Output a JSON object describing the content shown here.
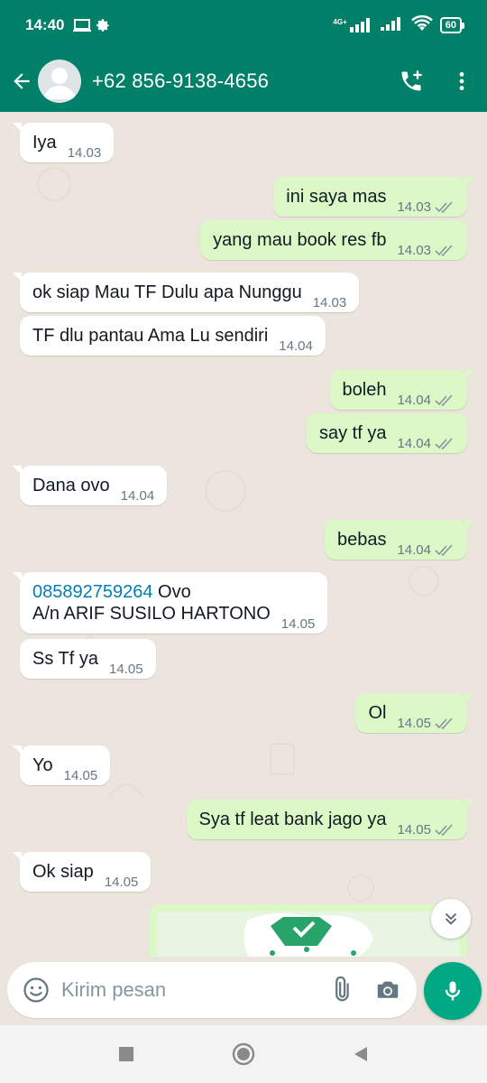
{
  "status_bar": {
    "time": "14:40",
    "network_label": "4G+",
    "battery": "60"
  },
  "header": {
    "contact_name": "+62 856-9138-4656"
  },
  "messages": [
    {
      "dir": "in",
      "text": "Iya",
      "time": "14.03"
    },
    {
      "dir": "out",
      "text": "ini saya mas",
      "time": "14.03"
    },
    {
      "dir": "out",
      "text": "yang mau book res fb",
      "time": "14.03"
    },
    {
      "dir": "in",
      "text": "ok siap Mau TF Dulu apa Nunggu",
      "time": "14.03"
    },
    {
      "dir": "in",
      "text": "TF dlu pantau Ama Lu sendiri",
      "time": "14.04"
    },
    {
      "dir": "out",
      "text": "boleh",
      "time": "14.04"
    },
    {
      "dir": "out",
      "text": "say tf ya",
      "time": "14.04"
    },
    {
      "dir": "in",
      "text": "Dana ovo",
      "time": "14.04"
    },
    {
      "dir": "out",
      "text": "bebas",
      "time": "14.04"
    },
    {
      "dir": "in",
      "link": "085892759264",
      "text_after_link": " Ovo",
      "line2": "A/n ARIF SUSILO HARTONO",
      "time": "14.05"
    },
    {
      "dir": "in",
      "text": "Ss Tf ya",
      "time": "14.05"
    },
    {
      "dir": "out",
      "text": "Ol",
      "time": "14.05"
    },
    {
      "dir": "in",
      "text": "Yo",
      "time": "14.05"
    },
    {
      "dir": "out",
      "text": "Sya tf leat bank jago ya",
      "time": "14.05"
    },
    {
      "dir": "in",
      "text": "Ok siap",
      "time": "14.05"
    }
  ],
  "compose": {
    "placeholder": "Kirim pesan"
  },
  "colors": {
    "header": "#008069",
    "outgoing_bubble": "#dcf8c6",
    "incoming_bubble": "#ffffff",
    "chat_bg": "#ece5dd",
    "mic_button": "#00a884",
    "link": "#027eb5"
  },
  "icons": [
    "back-arrow-icon",
    "avatar-placeholder-icon",
    "add-call-icon",
    "more-vert-icon",
    "double-check-icon",
    "chevron-double-down-icon",
    "emoji-icon",
    "attach-icon",
    "camera-icon",
    "mic-icon",
    "nav-recents-icon",
    "nav-home-icon",
    "nav-back-icon"
  ]
}
